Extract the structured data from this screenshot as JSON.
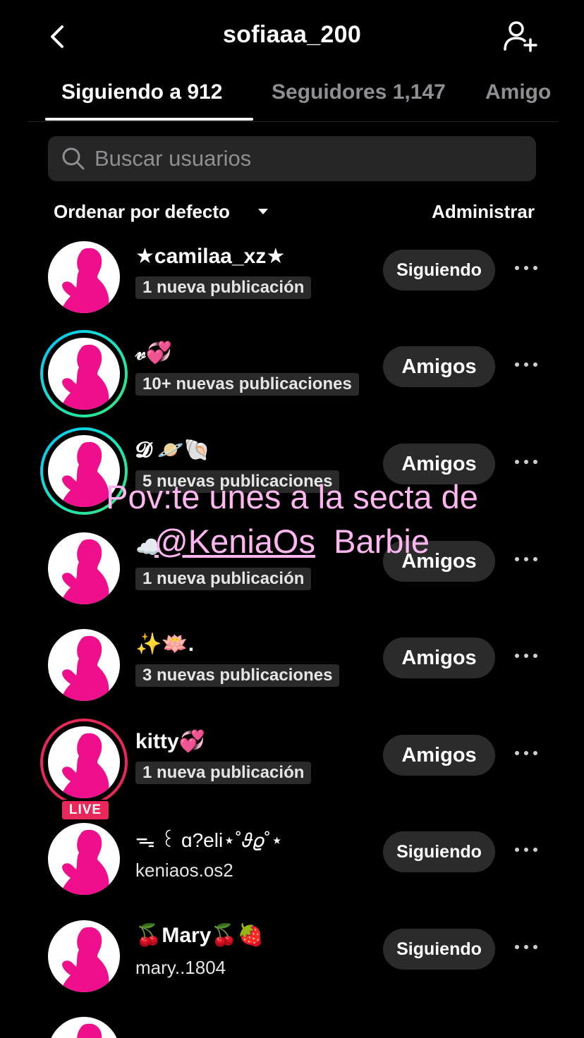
{
  "header": {
    "title": "sofiaaa_200"
  },
  "tabs": [
    {
      "label": "Siguiendo a 912"
    },
    {
      "label": "Seguidores 1,147"
    },
    {
      "label": "Amigo"
    }
  ],
  "search": {
    "placeholder": "Buscar usuarios"
  },
  "sort": {
    "label": "Ordenar por defecto",
    "manage_label": "Administrar"
  },
  "rows": [
    {
      "name": "★camilaa_xz★",
      "subtitle": "1 nueva publicación",
      "button": "Siguiendo"
    },
    {
      "name": "𝓋💞",
      "subtitle": "10+ nuevas publicaciones",
      "button": "Amigos"
    },
    {
      "name": "𝓓 🪐🐚",
      "subtitle": "5 nuevas publicaciones",
      "button": "Amigos"
    },
    {
      "name": "☁️",
      "subtitle": "1 nueva publicación",
      "button": "Amigos"
    },
    {
      "name": "✨🪷.",
      "subtitle": "3 nuevas publicaciones",
      "button": "Amigos"
    },
    {
      "name": "kitty💞",
      "subtitle": "1 nueva publicación",
      "button": "Amigos",
      "badge": "LIVE"
    },
    {
      "name": "ᯓ ꒰ ɑ?eli⋆˚𝜗𝜚˚⋆",
      "subtitle": "keniaos.os2",
      "button": "Siguiendo"
    },
    {
      "name": "🍒Mary🍒🍓",
      "subtitle": "mary..1804",
      "button": "Siguiendo"
    }
  ],
  "overlay": {
    "line1": "Pov:te unes a la secta de",
    "mention": "@KeniaOs",
    "line2_rest": "  Barbie"
  },
  "colors": {
    "background": "#000000",
    "pill": "#2b2b2b",
    "story_ring": "#17e6c3",
    "live": "#e8285a",
    "avatar_pink": "#ef0f8c",
    "overlay_text": "#ffb6f0"
  }
}
